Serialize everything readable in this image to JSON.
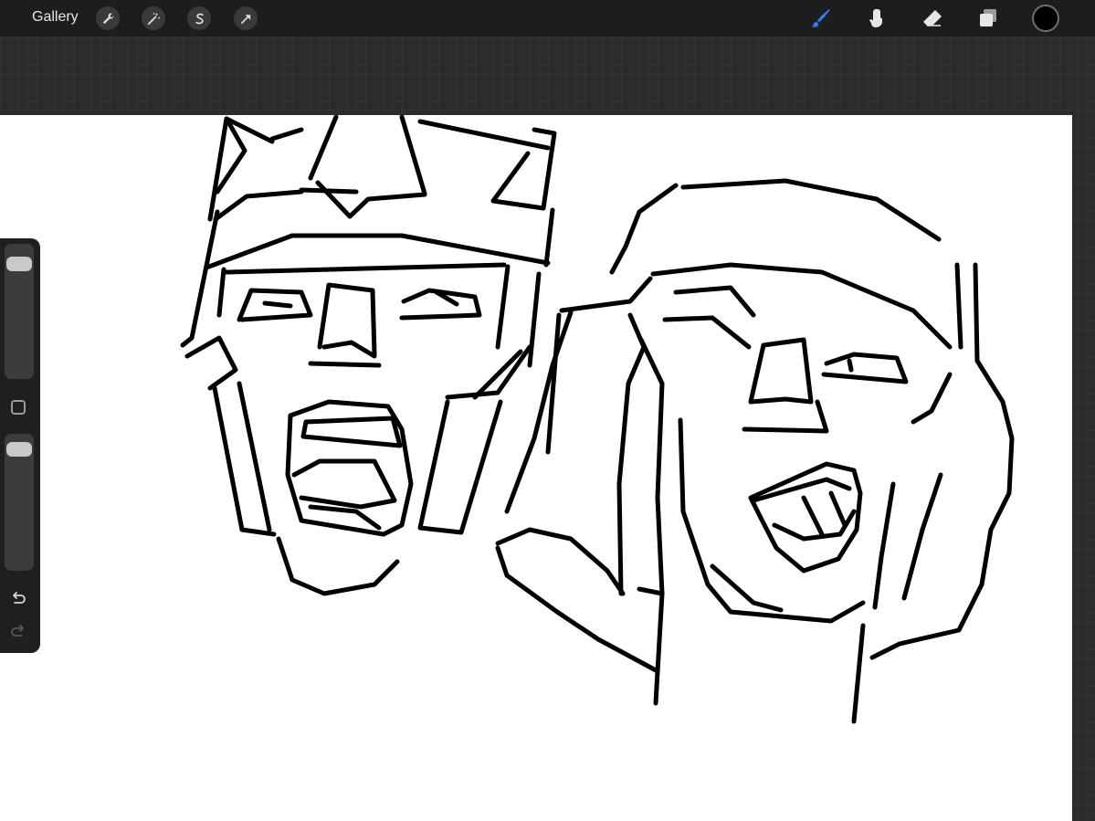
{
  "toolbar": {
    "gallery_label": "Gallery",
    "left_tools": [
      {
        "name": "actions",
        "icon": "wrench-icon"
      },
      {
        "name": "adjustments",
        "icon": "magic-wand-icon"
      },
      {
        "name": "selection",
        "icon": "selection-s-icon"
      },
      {
        "name": "transform",
        "icon": "arrow-cursor-icon"
      }
    ],
    "right_tools": [
      {
        "name": "brush",
        "icon": "brush-icon",
        "active": true
      },
      {
        "name": "smudge",
        "icon": "smudge-finger-icon",
        "active": false
      },
      {
        "name": "eraser",
        "icon": "eraser-icon",
        "active": false
      },
      {
        "name": "layers",
        "icon": "layers-icon",
        "active": false
      }
    ],
    "current_color": "#000000"
  },
  "sidebar": {
    "brush_size_level": 0.09,
    "brush_opacity_level": 0.05,
    "modify_icon": "square-icon",
    "undo_icon": "undo-arrow-icon",
    "redo_icon": "redo-arrow-icon"
  },
  "colors": {
    "accent": "#2f7bf5",
    "toolbar_bg": "#1d1d1d",
    "workspace_bg": "#2b2b2b",
    "canvas_bg": "#ffffff",
    "stroke": "#000000"
  }
}
